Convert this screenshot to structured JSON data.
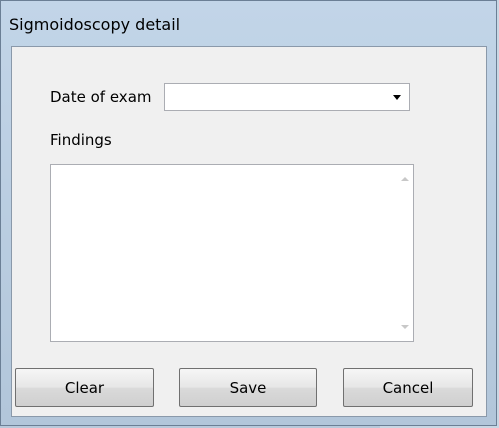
{
  "window": {
    "title": "Sigmoidoscopy detail"
  },
  "form": {
    "date_label": "Date of exam",
    "date_value": "",
    "findings_label": "Findings",
    "findings_value": ""
  },
  "buttons": {
    "clear": "Clear",
    "save": "Save",
    "cancel": "Cancel"
  },
  "icons": {
    "combo_arrow": "chevron-down-icon",
    "scroll_up": "scroll-up-arrow-icon",
    "scroll_down": "scroll-down-arrow-icon"
  },
  "colors": {
    "frame": "#b8cde2",
    "client": "#f0f0f0",
    "field": "#ffffff"
  }
}
